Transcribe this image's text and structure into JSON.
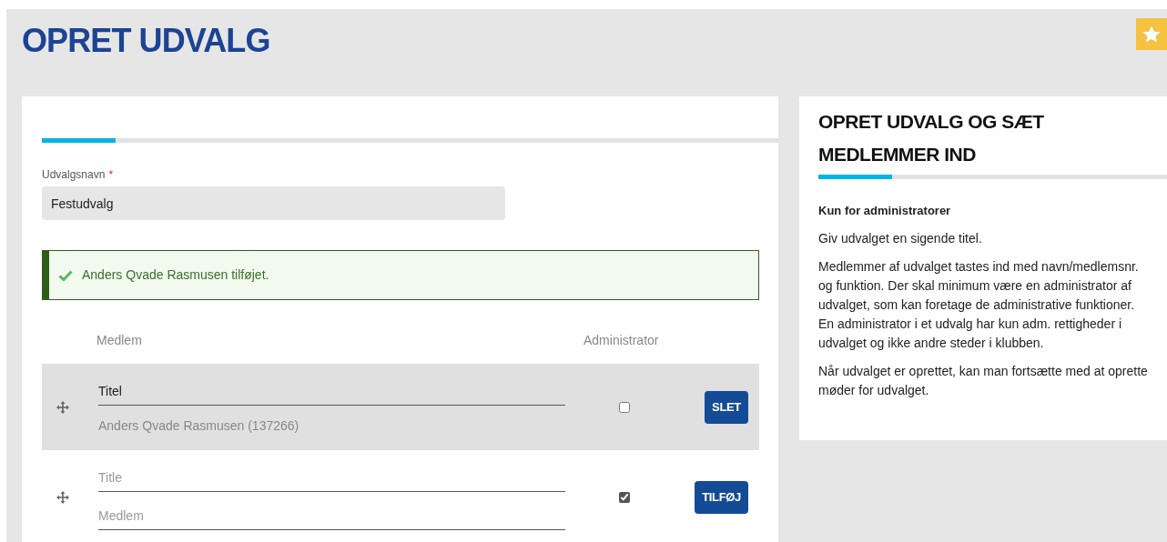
{
  "page_title": "OPRET UDVALG",
  "form": {
    "name_label": "Udvalgsnavn",
    "required_mark": "*",
    "name_value": "Festudvalg",
    "alert": {
      "text": "Anders Qvade Rasmusen tilføjet."
    },
    "columns": [
      "Medlem",
      "Administrator"
    ],
    "rows": [
      {
        "kind": "existing",
        "title": {
          "value": "Titel"
        },
        "member": {
          "value": "Anders Qvade Rasmusen (137266)"
        },
        "admin": false,
        "button": "SLET"
      },
      {
        "kind": "new",
        "title": {
          "placeholder": "Title"
        },
        "member": {
          "placeholder": "Medlem"
        },
        "admin": true,
        "button": "TILFØJ"
      }
    ]
  },
  "help": {
    "title": "OPRET UDVALG OG SÆT MEDLEMMER IND",
    "subtitle": "Kun for administratorer",
    "paragraphs": [
      "Giv udvalget en sigende titel.",
      "Medlemmer af udvalget tastes ind med navn/medlemsnr. og funktion. Der skal minimum være en administrator af udvalget, som kan foretage de administrative funktioner. En administrator i et udvalg har kun adm. rettigheder i udvalget og ikke andre steder i klubben.",
      "Når udvalget er oprettet, kan man fortsætte med at oprette møder for udvalget."
    ]
  }
}
